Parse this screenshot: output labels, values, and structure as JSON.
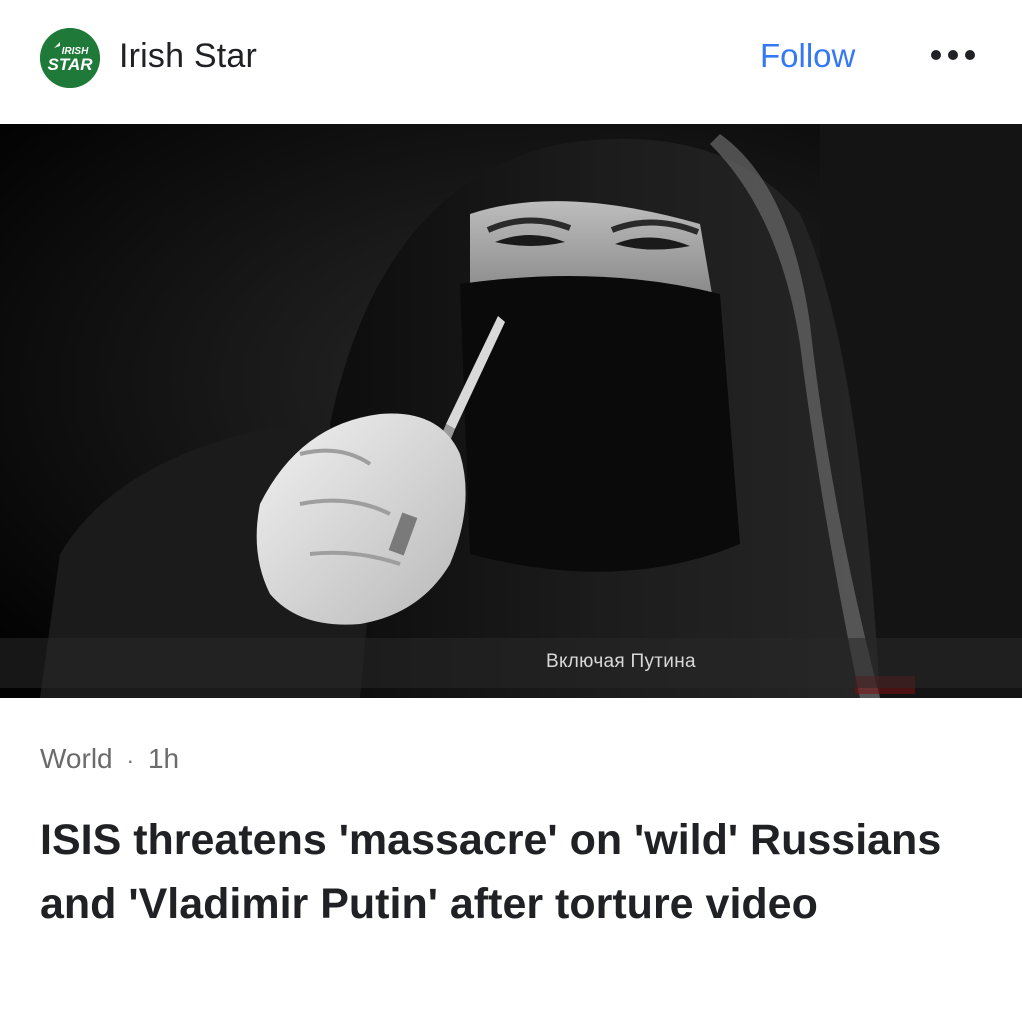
{
  "publisher": {
    "name": "Irish Star",
    "logo_text_top": "IRISH",
    "logo_text_bottom": "STAR",
    "logo_color": "#1f7a3a"
  },
  "actions": {
    "follow_label": "Follow",
    "follow_color": "#3478f6",
    "more_icon": "more-horizontal-icon"
  },
  "hero_image": {
    "caption": "Включая Путина"
  },
  "article": {
    "category": "World",
    "separator": "·",
    "age": "1h",
    "headline": "ISIS threatens 'massacre' on 'wild' Russians and 'Vladimir Putin' after torture video"
  }
}
